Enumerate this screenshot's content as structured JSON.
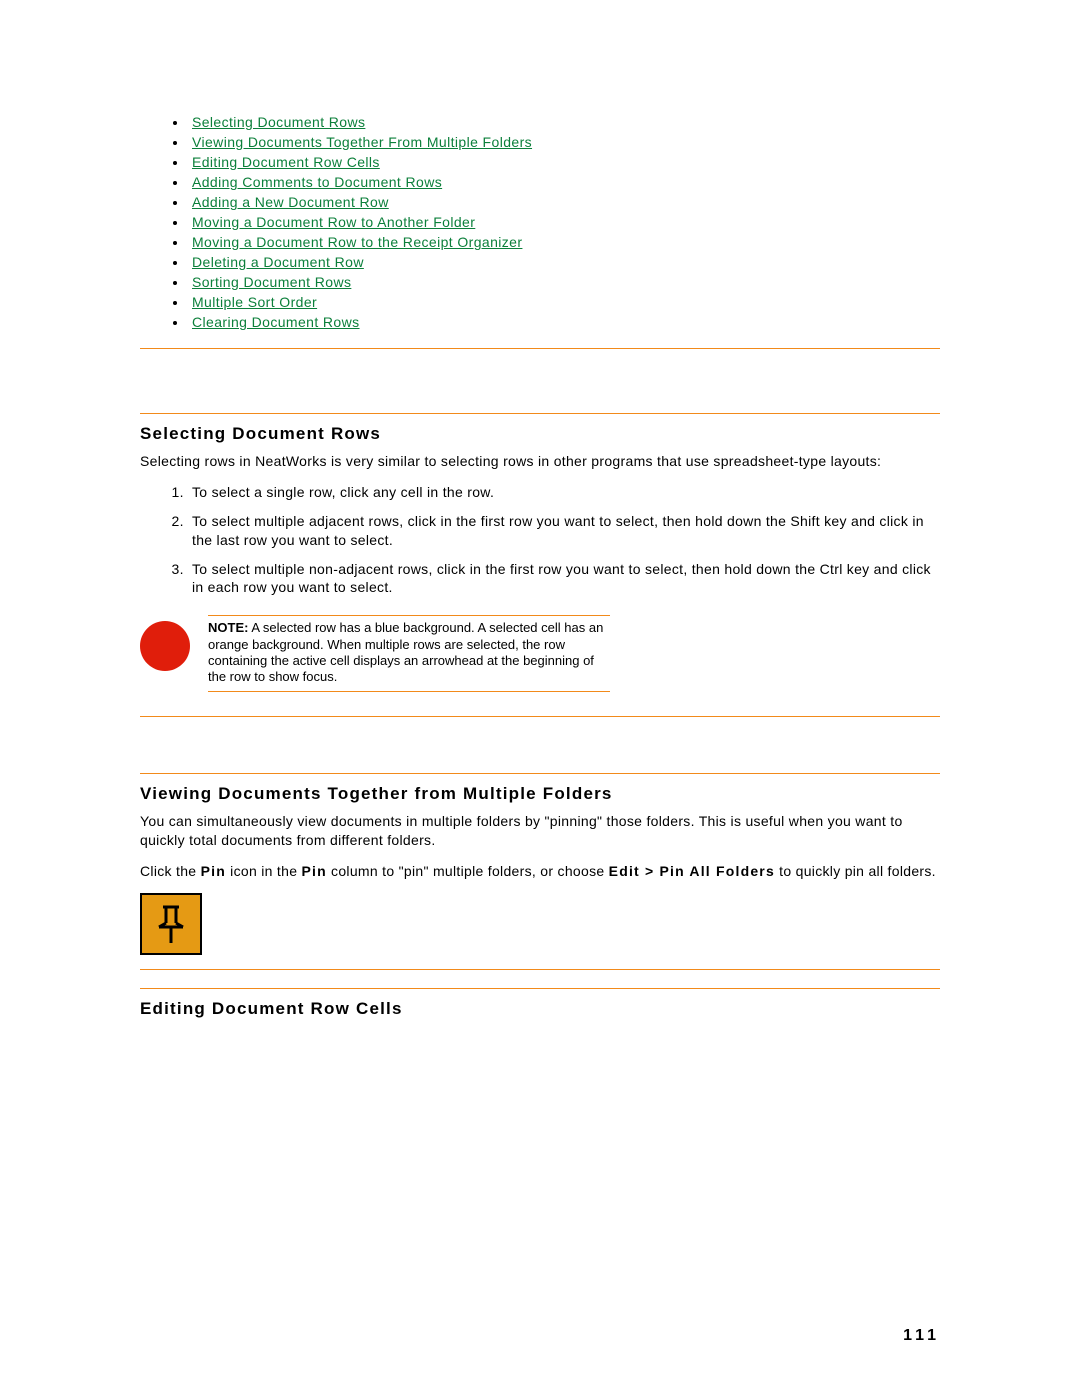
{
  "toc": {
    "items": [
      "Selecting Document Rows",
      "Viewing Documents Together From Multiple Folders",
      "Editing Document Row Cells",
      "Adding Comments to Document Rows",
      "Adding a New Document Row",
      "Moving a Document Row to Another Folder",
      "Moving a Document Row to the Receipt Organizer",
      "Deleting a Document Row",
      "Sorting Document Rows",
      "Multiple Sort Order",
      "Clearing Document Rows"
    ]
  },
  "section1": {
    "heading": "Selecting Document Rows",
    "intro": "Selecting rows in NeatWorks is very similar to selecting rows in other programs that use spreadsheet-type layouts:",
    "steps": [
      "To select a single row, click any cell in the row.",
      "To select multiple adjacent rows, click in the first row you want to select, then hold down the Shift key and click in the last row you want to select.",
      "To select multiple non-adjacent rows, click in the first row you want to select, then hold down the Ctrl key and click in each row you want to select."
    ],
    "note_label": "NOTE:",
    "note_body": " A selected row has a blue background. A selected cell has an orange background. When multiple rows are selected, the row containing the active cell displays an arrowhead at the beginning of the row to show focus."
  },
  "section2": {
    "heading": "Viewing Documents Together from Multiple Folders",
    "p1": "You can simultaneously view documents in multiple folders by \"pinning\" those folders. This is useful when you want to quickly total documents from different folders.",
    "p2_parts": {
      "a": "Click the ",
      "pin1": "Pin",
      "b": " icon in the ",
      "pin2": "Pin",
      "c": " column to \"pin\" multiple folders, or choose ",
      "menu": "Edit > Pin All Folders",
      "d": " to quickly pin all folders."
    }
  },
  "section3": {
    "heading": "Editing Document Row Cells"
  },
  "page_number": "111"
}
